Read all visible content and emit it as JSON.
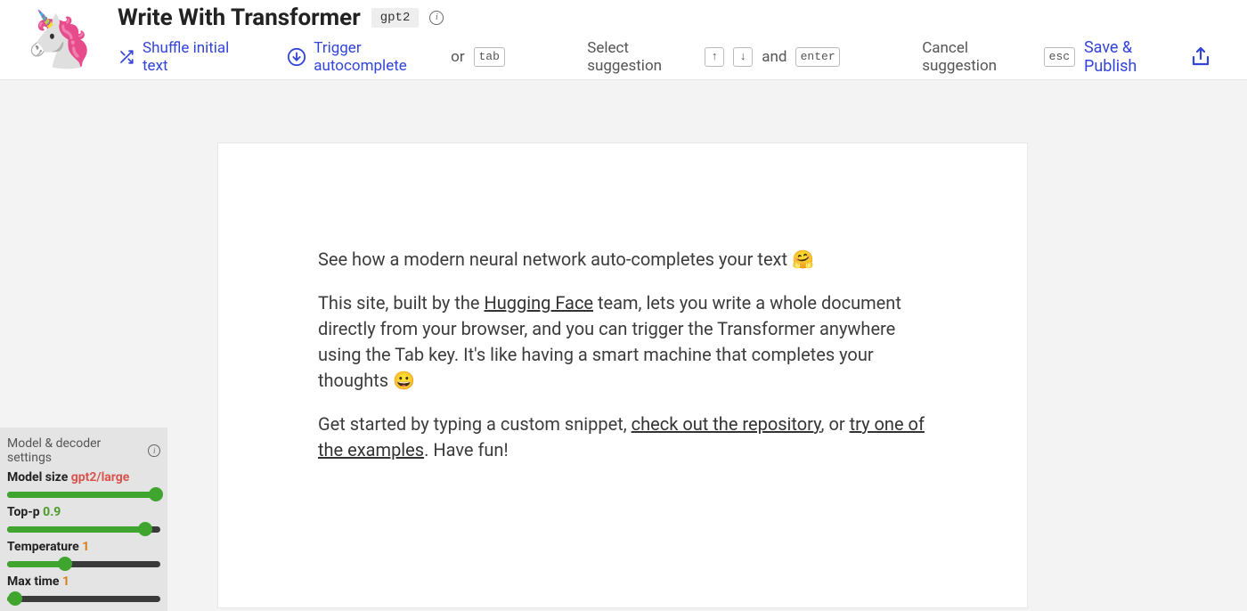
{
  "header": {
    "title": "Write With Transformer",
    "model_badge": "gpt2",
    "logo_emoji": "🦄",
    "actions": {
      "shuffle_label": "Shuffle initial text",
      "trigger_label": "Trigger autocomplete",
      "or_label": "or",
      "tab_key": "tab",
      "select_label": "Select suggestion",
      "up_key": "↑",
      "down_key": "↓",
      "and_label": "and",
      "enter_key": "enter",
      "cancel_label": "Cancel suggestion",
      "esc_key": "esc"
    },
    "save_publish_label": "Save & Publish"
  },
  "editor": {
    "p1_prefix": "See how a modern neural network auto-completes your text ",
    "p1_emoji": "🤗",
    "p2_prefix": "This site, built by the ",
    "p2_link1": "Hugging Face",
    "p2_mid": " team, lets you write a whole document directly from your browser, and you can trigger the Transformer anywhere using the Tab key. It's like having a smart machine that completes your thoughts ",
    "p2_emoji": "😀",
    "p3_prefix": "Get started by typing a custom snippet, ",
    "p3_link1": "check out the repository",
    "p3_mid1": ", or ",
    "p3_link2": "try one of the examples",
    "p3_suffix": ". Have fun!"
  },
  "settings": {
    "panel_title": "Model & decoder settings",
    "model_size_label": "Model size",
    "model_size_value": "gpt2/large",
    "model_size_fill_pct": 97,
    "top_p_label": "Top-p",
    "top_p_value": "0.9",
    "top_p_fill_pct": 90,
    "temperature_label": "Temperature",
    "temperature_value": "1",
    "temperature_fill_pct": 38,
    "max_time_label": "Max time",
    "max_time_value": "1",
    "max_time_fill_pct": 5
  }
}
